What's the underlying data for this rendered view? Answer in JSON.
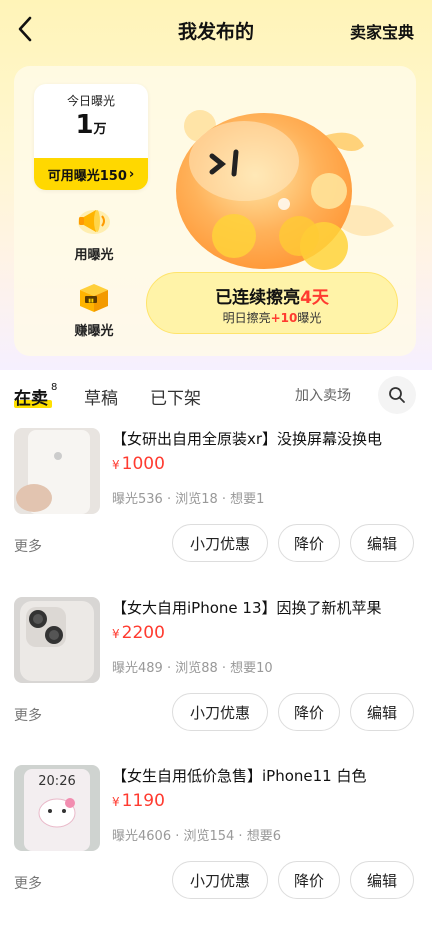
{
  "header": {
    "title": "我发布的",
    "right_link": "卖家宝典"
  },
  "exposure": {
    "label": "今日曝光",
    "value": "1",
    "unit": "万",
    "available": "可用曝光150"
  },
  "side_actions": [
    {
      "label": "用曝光",
      "icon": "megaphone-icon"
    },
    {
      "label": "赚曝光",
      "icon": "box-icon"
    }
  ],
  "streak": {
    "title_prefix": "已连续擦亮",
    "days": "4天",
    "subtitle_prefix": "明日擦亮",
    "bonus": "+10",
    "subtitle_suffix": "曝光"
  },
  "tabs": {
    "items": [
      {
        "label": "在卖",
        "count": "8"
      },
      {
        "label": "草稿"
      },
      {
        "label": "已下架"
      }
    ],
    "join_label": "加入卖场"
  },
  "listings": [
    {
      "title": "【女研出自用全原装xr】没换屏幕没换电",
      "currency": "¥",
      "price": "1000",
      "stats": "曝光536 · 浏览18 · 想要1",
      "more": "更多",
      "actions": [
        "小刀优惠",
        "降价",
        "编辑"
      ]
    },
    {
      "title": "【女大自用iPhone 13】因换了新机苹果",
      "currency": "¥",
      "price": "2200",
      "stats": "曝光489 · 浏览88 · 想要10",
      "more": "更多",
      "actions": [
        "小刀优惠",
        "降价",
        "编辑"
      ]
    },
    {
      "title": "【女生自用低价急售】iPhone11 白色",
      "currency": "¥",
      "price": "1190",
      "stats": "曝光4606 · 浏览154 · 想要6",
      "more": "更多",
      "actions": [
        "小刀优惠",
        "降价",
        "编辑"
      ],
      "thumb_text": "20:26"
    }
  ],
  "colors": {
    "accent": "#ffd800",
    "price": "#ff3b30"
  }
}
